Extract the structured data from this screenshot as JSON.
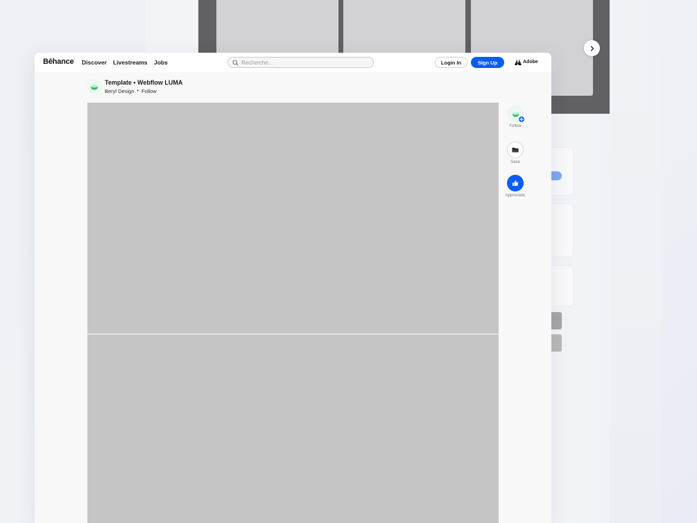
{
  "nav": {
    "logo": "Bēhance",
    "links": [
      "Discover",
      "Livestreams",
      "Jobs"
    ],
    "search_placeholder": "Recherche...",
    "login_label": "Login In",
    "signup_label": "Sign Up",
    "adobe_label": "Adobe"
  },
  "project": {
    "title": "Template • Webflow LUMA",
    "owner": "Beryl Design",
    "separator": "•",
    "follow_label": "Follow"
  },
  "actions": {
    "follow_label": "Follow",
    "save_label": "Save",
    "appreciate_label": "Appreciate"
  },
  "colors": {
    "brand_blue": "#0b5cf5",
    "image_placeholder": "#c5c5c5",
    "dark_block": "#616163"
  }
}
